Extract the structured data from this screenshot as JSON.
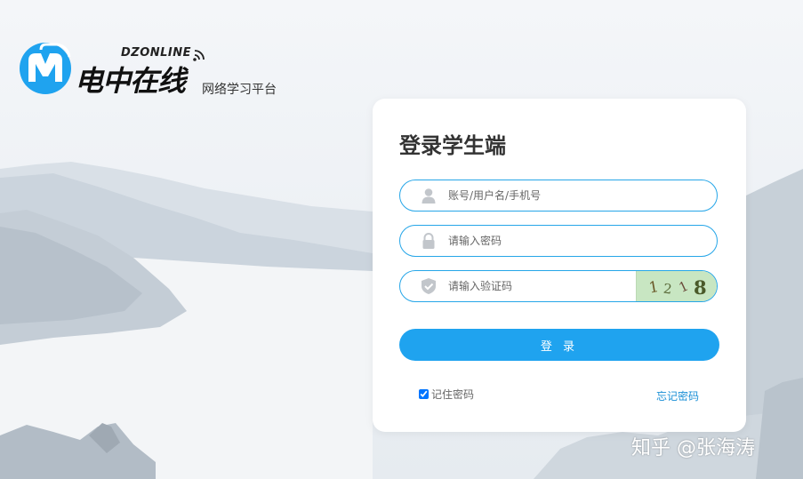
{
  "logo": {
    "brand_en": "DZONLINE",
    "brand_cn": "电中在线",
    "subtitle": "网络学习平台",
    "accent": "#1fa3ef"
  },
  "login": {
    "title": "登录学生端",
    "username_placeholder": "账号/用户名/手机号",
    "password_placeholder": "请输入密码",
    "captcha_placeholder": "请输入验证码",
    "captcha_code": "1218",
    "submit_label": "登 录",
    "remember_label": "记住密码",
    "remember_checked": true,
    "forgot_label": "忘记密码"
  },
  "icons": {
    "username": "user-icon",
    "password": "lock-icon",
    "captcha": "shield-check-icon"
  },
  "watermark": "知乎 @张海涛"
}
